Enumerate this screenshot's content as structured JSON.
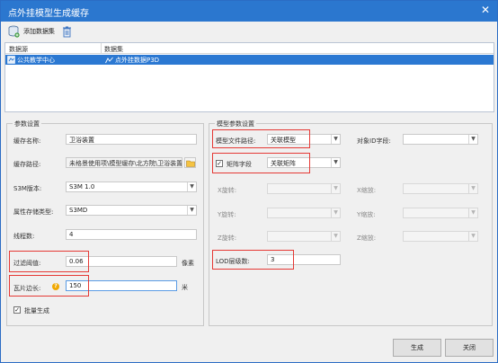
{
  "window": {
    "title": "点外挂模型生成缓存",
    "close_glyph": "✕"
  },
  "toolbar": {
    "add_label": "添加数据集"
  },
  "grid": {
    "columns": [
      "数据源",
      "数据集"
    ],
    "rows": [
      {
        "datasource": "公共教学中心",
        "dataset": "点外挂数据P3D"
      }
    ]
  },
  "params": {
    "legend": "参数设置",
    "cache_name": {
      "label": "缓存名称:",
      "value": "卫浴装置"
    },
    "cache_path": {
      "label": "缓存路径:",
      "value": "未格景使用项\\模型缓存\\北方院\\卫浴装置"
    },
    "s3m_version": {
      "label": "S3M版本:",
      "value": "S3M 1.0"
    },
    "attr_storage": {
      "label": "属性存储类型:",
      "value": "S3MD"
    },
    "threads": {
      "label": "线程数:",
      "value": "4"
    },
    "filter": {
      "label": "过滤阈值:",
      "value": "0.06",
      "unit": "像素"
    },
    "tile_side": {
      "label": "瓦片边长:",
      "value": "150",
      "unit": "米"
    },
    "batch": {
      "label": "批量生成",
      "checked": true
    }
  },
  "model_params": {
    "legend": "模型参数设置",
    "model_file_path": {
      "label": "模型文件路径:",
      "value": "关联模型"
    },
    "object_id_field": {
      "label": "对象ID字段:",
      "value": ""
    },
    "matrix_field": {
      "label": "矩阵字段",
      "value": "关联矩阵",
      "checked": true
    },
    "x_rotate": {
      "label": "X旋转:",
      "value": ""
    },
    "x_scale": {
      "label": "X缩放:",
      "value": ""
    },
    "y_rotate": {
      "label": "Y旋转:",
      "value": ""
    },
    "y_scale": {
      "label": "Y缩放:",
      "value": ""
    },
    "z_rotate": {
      "label": "Z旋转:",
      "value": ""
    },
    "z_scale": {
      "label": "Z缩放:",
      "value": ""
    },
    "lod_levels": {
      "label": "LOD层级数:",
      "value": "3"
    }
  },
  "buttons": {
    "generate": "生成",
    "close": "关闭"
  },
  "colors": {
    "title_bar": "#2b77cf",
    "selection": "#2b78d2",
    "highlight": "#e53935",
    "help": "#f0a800"
  },
  "icons": [
    "database-add-icon",
    "trash-icon",
    "close-icon",
    "folder-icon",
    "help-icon",
    "chevron-down-icon",
    "checkbox-icon"
  ]
}
